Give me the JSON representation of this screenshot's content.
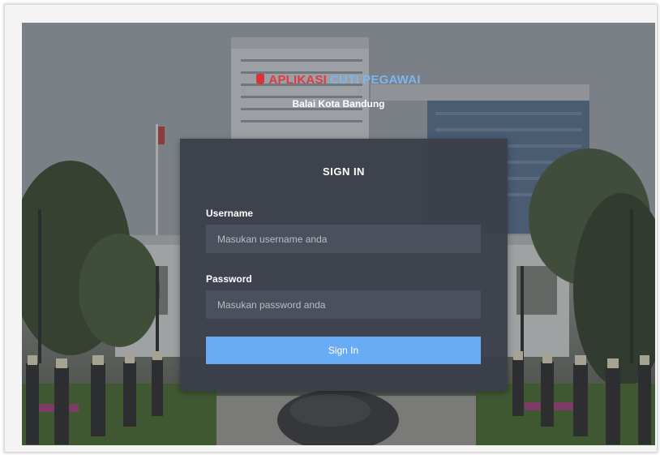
{
  "app": {
    "title_part1": "APLIKASI",
    "title_part2": "CUTI PEGAWAI",
    "subtitle": "Balai Kota Bandung"
  },
  "login": {
    "heading": "SIGN IN",
    "username_label": "Username",
    "username_placeholder": "Masukan username anda",
    "password_label": "Password",
    "password_placeholder": "Masukan password anda",
    "submit_label": "Sign In"
  },
  "colors": {
    "title_red": "#e2383f",
    "title_blue": "#7ab6f0",
    "card_bg": "#3a3f4a",
    "input_bg": "#4a505c",
    "button": "#6aacf3"
  },
  "icons": {
    "logo": "app-logo-icon"
  }
}
